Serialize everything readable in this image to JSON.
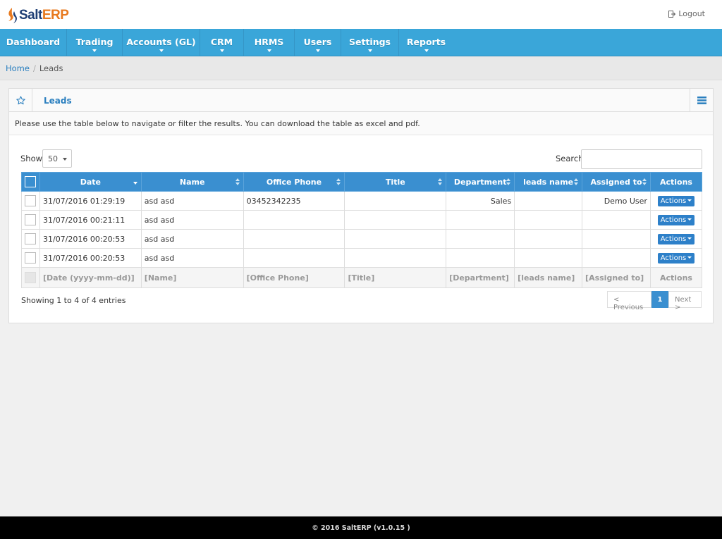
{
  "app": {
    "logo_text_a": "Salt",
    "logo_text_b": "ERP",
    "logout_label": "Logout"
  },
  "nav": {
    "items": [
      {
        "label": "Dashboard",
        "has_caret": false
      },
      {
        "label": "Trading",
        "has_caret": true
      },
      {
        "label": "Accounts (GL)",
        "has_caret": true
      },
      {
        "label": "CRM",
        "has_caret": true
      },
      {
        "label": "HRMS",
        "has_caret": true
      },
      {
        "label": "Users",
        "has_caret": true
      },
      {
        "label": "Settings",
        "has_caret": true
      },
      {
        "label": "Reports",
        "has_caret": true
      }
    ]
  },
  "breadcrumb": {
    "home": "Home",
    "current": "Leads"
  },
  "panel": {
    "title": "Leads",
    "description": "Please use the table below to navigate or filter the results. You can download the table as excel and pdf."
  },
  "controls": {
    "show_label": "Show",
    "show_value": "50",
    "search_label": "Search",
    "search_value": ""
  },
  "table": {
    "headers": [
      "Date",
      "Name",
      "Office Phone",
      "Title",
      "Department",
      "leads name",
      "Assigned to",
      "Actions"
    ],
    "rows": [
      {
        "date": "31/07/2016 01:29:19",
        "name": "asd asd",
        "office_phone": "03452342235",
        "title": "",
        "department": "Sales",
        "leads_name": "",
        "assigned_to": "Demo User",
        "action": "Actions"
      },
      {
        "date": "31/07/2016 00:21:11",
        "name": "asd asd",
        "office_phone": "",
        "title": "",
        "department": "",
        "leads_name": "",
        "assigned_to": "",
        "action": "Actions"
      },
      {
        "date": "31/07/2016 00:20:53",
        "name": "asd asd",
        "office_phone": "",
        "title": "",
        "department": "",
        "leads_name": "",
        "assigned_to": "",
        "action": "Actions"
      },
      {
        "date": "31/07/2016 00:20:53",
        "name": "asd asd",
        "office_phone": "",
        "title": "",
        "department": "",
        "leads_name": "",
        "assigned_to": "",
        "action": "Actions"
      }
    ],
    "filters": [
      "[Date (yyyy-mm-dd)]",
      "[Name]",
      "[Office Phone]",
      "[Title]",
      "[Department]",
      "[leads name]",
      "[Assigned to]",
      "Actions"
    ]
  },
  "pagination": {
    "info": "Showing 1 to 4 of 4 entries",
    "prev": "< Previous",
    "page": "1",
    "next": "Next >"
  },
  "footer": {
    "text": "© 2016 SaltERP (v1.0.15 )"
  },
  "colors": {
    "nav_bg": "#3aa6d9",
    "table_header_bg": "#3a8fd0",
    "link": "#2a7fbf",
    "logo_blue": "#1f3f75",
    "logo_orange": "#e8791e"
  },
  "icons": {
    "logo": "salt-logo-icon",
    "logout": "logout-icon",
    "star": "star-icon",
    "panel_menu": "list-menu-icon"
  }
}
